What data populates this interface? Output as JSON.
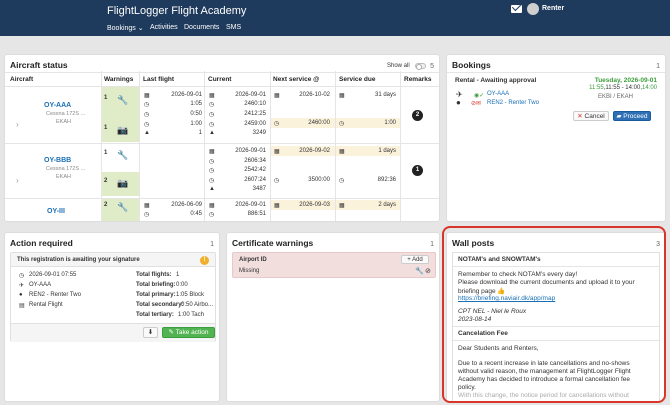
{
  "app": {
    "title": "FlightLogger Flight Academy",
    "user": "Renter"
  },
  "nav": {
    "bookings": "Bookings",
    "activities": "Activities",
    "documents": "Documents",
    "sms": "SMS",
    "chevron": "⌄"
  },
  "aircraft_status": {
    "title": "Aircraft status",
    "show_all": "Show all",
    "count": "5",
    "columns": [
      "Aircraft",
      "Warnings",
      "Last flight",
      "Current",
      "Next service @",
      "Service due",
      "Remarks"
    ],
    "rows": [
      {
        "reg": "OY-AAA",
        "model": "Cessna 172S ...",
        "base": "EKAH",
        "warn1": "1",
        "warn2": "1",
        "last": [
          "2026-09-01",
          "1:05",
          "0:50",
          "1:00",
          "1"
        ],
        "current": [
          "2026-09-01",
          "2460:10",
          "2412:25",
          "2459:00",
          "3249"
        ],
        "next1": "2026-10-02",
        "next2": "2460:00",
        "due1": "31 days",
        "due2": "1:00",
        "remarks": "2"
      },
      {
        "reg": "OY-BBB",
        "model": "Cessna 172S ...",
        "base": "EKAH",
        "warn1": "1",
        "warn2": "2",
        "current": [
          "2026-09-01",
          "2606:34",
          "2542:42",
          "2607:24",
          "3487"
        ],
        "next1": "2026-09-02",
        "next2": "3500:00",
        "due1": "1 days",
        "due2": "892:36",
        "remarks": "1"
      },
      {
        "reg": "OY-III",
        "warn1": "2",
        "last": [
          "2026-06-09",
          "0:45"
        ],
        "current": [
          "2026-09-01",
          "886:51"
        ],
        "next1": "2026-09-03",
        "due1": "2 days"
      }
    ]
  },
  "bookings": {
    "title": "Bookings",
    "count": "1",
    "heading": "Rental - Awaiting approval",
    "date": "Tuesday, 2026-09-01",
    "time_start": "11:55",
    "time_mid": ",11:55 - 14:00,",
    "time_end": "14:00",
    "route": "EKBI / EKAH",
    "aircraft": "OY-AAA",
    "pilot": "REN2 - Renter Two",
    "cancel": "Cancel",
    "proceed": "Proceed"
  },
  "action_required": {
    "title": "Action required",
    "count": "1",
    "message": "This registration is awaiting your signature",
    "date": "2026-09-01 07:55",
    "aircraft": "OY-AAA",
    "pilot": "REN2 - Renter Two",
    "type": "Rental Flight",
    "totals": [
      {
        "label": "Total flights:",
        "value": "1"
      },
      {
        "label": "Total briefing:",
        "value": "0:00"
      },
      {
        "label": "Total primary:",
        "value": "1:05 Block"
      },
      {
        "label": "Total secondary:",
        "value": "0:50 Airbo..."
      },
      {
        "label": "Total tertiary:",
        "value": "1:00 Tach"
      }
    ],
    "take_action": "Take action"
  },
  "certificate_warnings": {
    "title": "Certificate warnings",
    "count": "1",
    "airport_id": "Airport ID",
    "add": "Add",
    "missing": "Missing"
  },
  "wall_posts": {
    "title": "Wall posts",
    "count": "3",
    "post1": {
      "title": "NOTAM's and SNOWTAM's",
      "line1": "Remember to check NOTAM's every day!",
      "line2": "Please download the current documents and upload it to your",
      "line3": "briefing page 👍",
      "link": "https://briefing.naviair.dk/app/map",
      "author": "CPT NEL - Niel le Roux",
      "date": "2023-08-14"
    },
    "post2": {
      "title": "Cancelation Fee",
      "line1": "Dear Students and Renters,",
      "line2": "Due to a recent increase in late cancellations and no-shows",
      "line3": "without valid reason, the management at FlightLogger Flight",
      "line4": "Academy has decided to introduce a formal cancellation fee",
      "line5": "policy.",
      "line6": "With this change, the notice period for cancellations without"
    }
  },
  "colors": {
    "topbar": "#1e3a5c",
    "link": "#1a6fb5",
    "green": "#3c9d3c",
    "highlight": "#d9362b"
  }
}
